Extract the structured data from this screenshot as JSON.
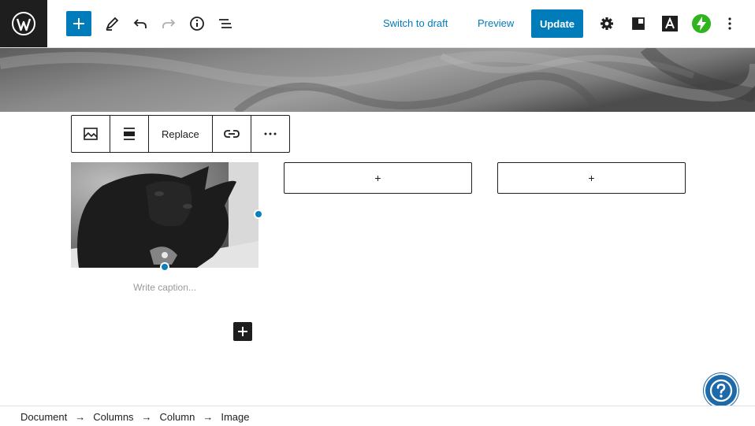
{
  "topbar": {
    "switch_to_draft": "Switch to draft",
    "preview": "Preview",
    "update": "Update",
    "icons": [
      "wordpress-logo",
      "plus",
      "pencil",
      "undo",
      "redo",
      "info",
      "list-view",
      "settings-gear",
      "blocks-panel",
      "font-a",
      "jetpack-bolt",
      "more-vertical"
    ]
  },
  "block_toolbar": {
    "replace_label": "Replace",
    "icons": [
      "image",
      "align",
      "link",
      "more-horizontal"
    ]
  },
  "image_block": {
    "caption_placeholder": "Write caption..."
  },
  "appenders": [
    {
      "label": "+"
    },
    {
      "label": "+"
    }
  ],
  "breadcrumb": {
    "items": [
      "Document",
      "Columns",
      "Column",
      "Image"
    ],
    "separator": "→"
  },
  "colors": {
    "accent": "#007cba",
    "jetpack_green": "#2fb41f",
    "dark": "#1e1e1e",
    "help": "#1e6aa8"
  }
}
